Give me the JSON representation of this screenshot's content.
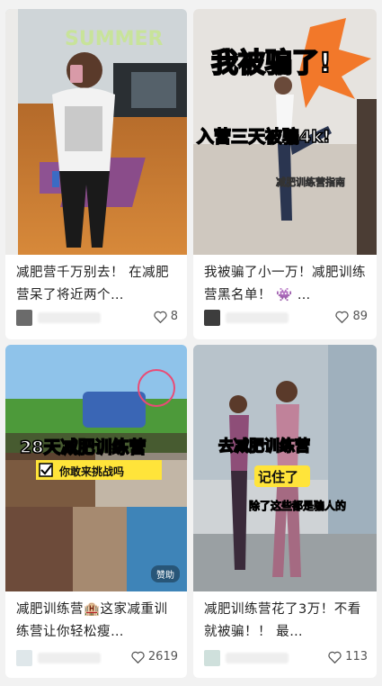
{
  "cards": [
    {
      "image_text": "SUMMER",
      "title": "减肥营千万别去！ 在减肥营呆了将近两个…",
      "likes": "8",
      "accent": "#e8c17a"
    },
    {
      "image_text": "我被骗了!",
      "image_text2": "入营三天被骗4k!",
      "image_text3": "减肥训练营指南",
      "title_a": "我被骗了小一万！减肥训练营黑名单！",
      "title_b": "…",
      "likes": "89"
    },
    {
      "image_text": "28天减肥训练营",
      "image_text2": "你敢来挑战吗",
      "sponsor": "赞助",
      "title": "减肥训练营🏨这家减重训练营让你轻松瘦…",
      "likes": "2619"
    },
    {
      "image_text": "去减肥训练营",
      "image_text2": "记住了",
      "image_text3": "除了这些都是骗人的",
      "title": "减肥训练营花了3万！不看就被骗！！ 最…",
      "likes": "113"
    }
  ]
}
